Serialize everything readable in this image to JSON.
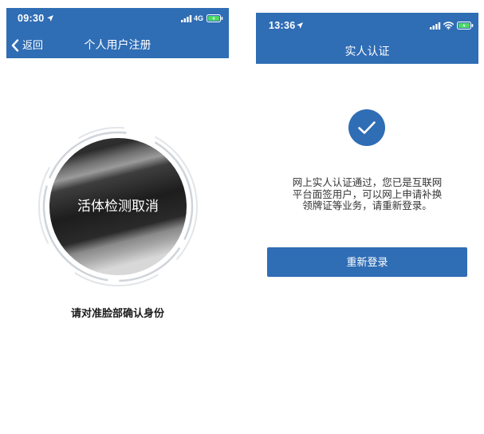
{
  "colors": {
    "brand_blue": "#2f6db5",
    "battery_green": "#4cd964"
  },
  "left_screen": {
    "status_bar": {
      "time": "09:30",
      "network": "4G",
      "icons": [
        "location-arrow-icon",
        "signal-icon",
        "battery-icon"
      ]
    },
    "nav": {
      "back_icon": "chevron-left-icon",
      "back_label": "返回",
      "title": "个人用户注册"
    },
    "camera": {
      "overlay_text": "活体检测取消"
    },
    "instruction": "请对准脸部确认身份"
  },
  "right_screen": {
    "status_bar": {
      "time": "13:36",
      "icons": [
        "location-arrow-icon",
        "signal-icon",
        "wifi-icon",
        "battery-icon"
      ]
    },
    "nav": {
      "title": "实人认证"
    },
    "success_icon": "checkmark-icon",
    "message_lines": [
      "网上实人认证通过，您已是互联网",
      "平台面签用户，可以网上申请补换",
      "领牌证等业务，请重新登录。"
    ],
    "relogin_button": "重新登录"
  }
}
